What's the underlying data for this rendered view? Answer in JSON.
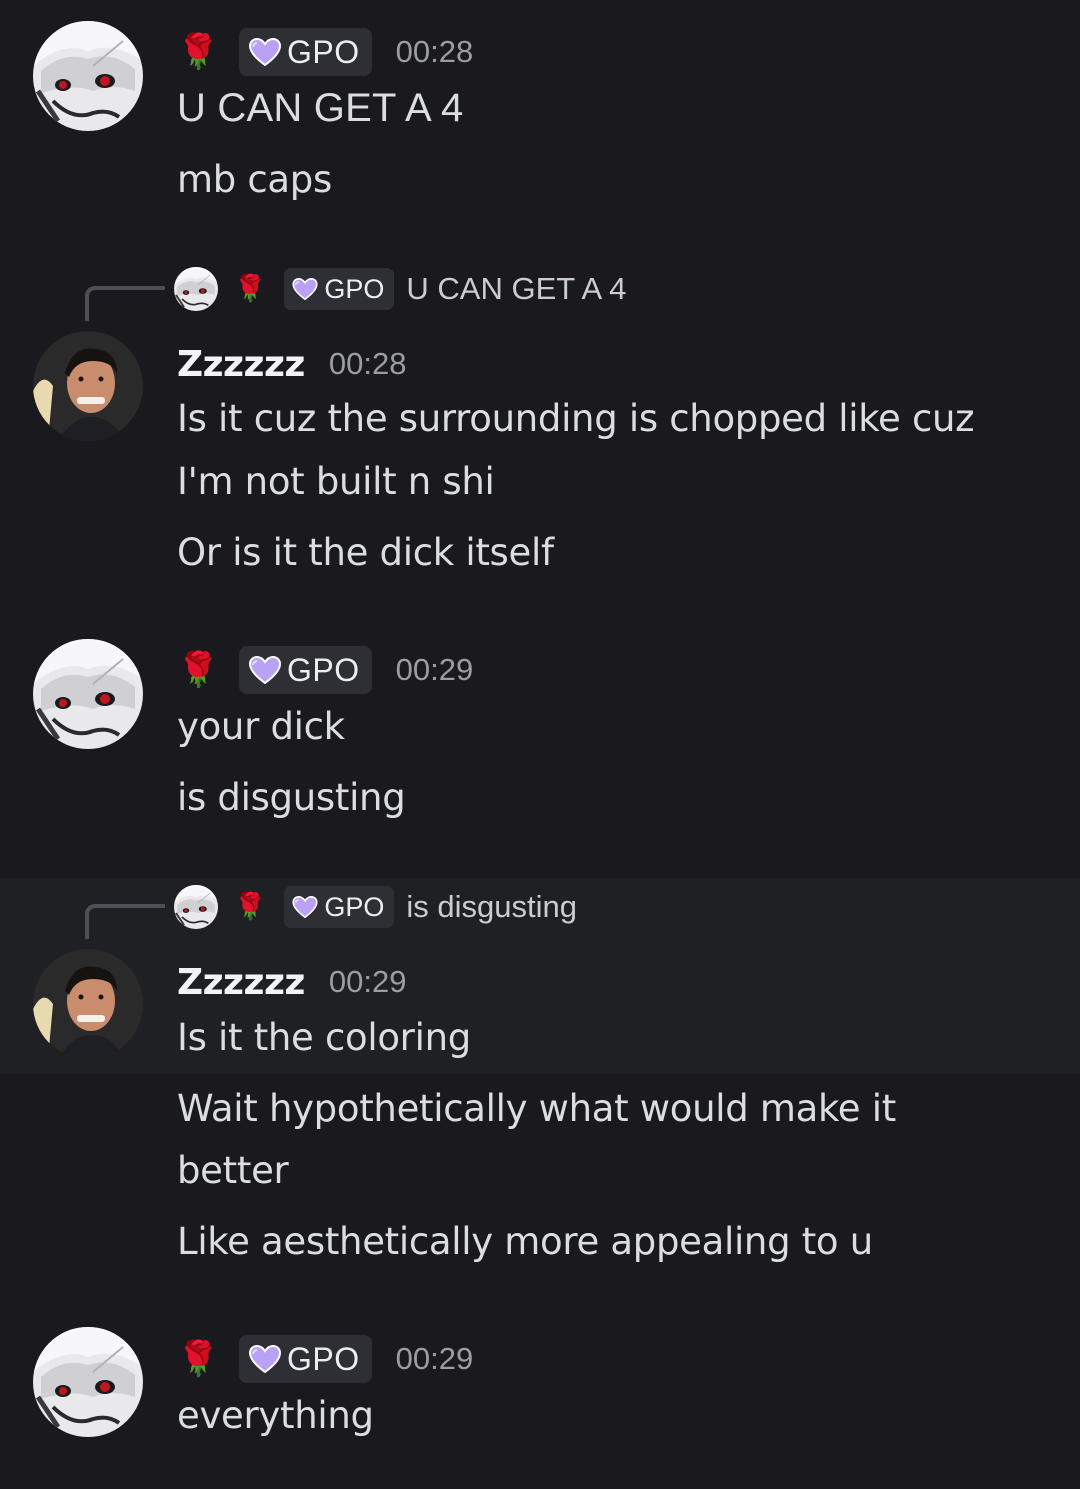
{
  "colors": {
    "background": "#1a1a1e",
    "tag_bg": "#2e2f35",
    "text": "#dbdee1",
    "muted": "#9a9da3",
    "rose": "#d4172f",
    "heart": "#b9a2f5"
  },
  "icons": {
    "rose": "rose-emoji",
    "heart": "purple-heart-icon"
  },
  "messages": [
    {
      "author_emoji": "🌹",
      "tag": "GPO",
      "time": "00:28",
      "lines": [
        "U CAN GET A 4",
        "mb caps"
      ]
    },
    {
      "reply": {
        "tag": "GPO",
        "text": "U CAN GET A 4"
      },
      "author": "Zzzzzz",
      "time": "00:28",
      "lines": [
        "Is it cuz the surrounding is chopped like cuz",
        "I'm not built n shi",
        "Or is it the dick itself"
      ]
    },
    {
      "author_emoji": "🌹",
      "tag": "GPO",
      "time": "00:29",
      "lines": [
        "your dick",
        "is disgusting"
      ]
    },
    {
      "reply": {
        "tag": "GPO",
        "text": "is disgusting"
      },
      "author": "Zzzzzz",
      "time": "00:29",
      "lines": [
        "Is it the coloring",
        "Wait hypothetically what would make it",
        "better",
        "Like aesthetically more appealing to u"
      ]
    },
    {
      "author_emoji": "🌹",
      "tag": "GPO",
      "time": "00:29",
      "lines": [
        "everything"
      ]
    }
  ]
}
